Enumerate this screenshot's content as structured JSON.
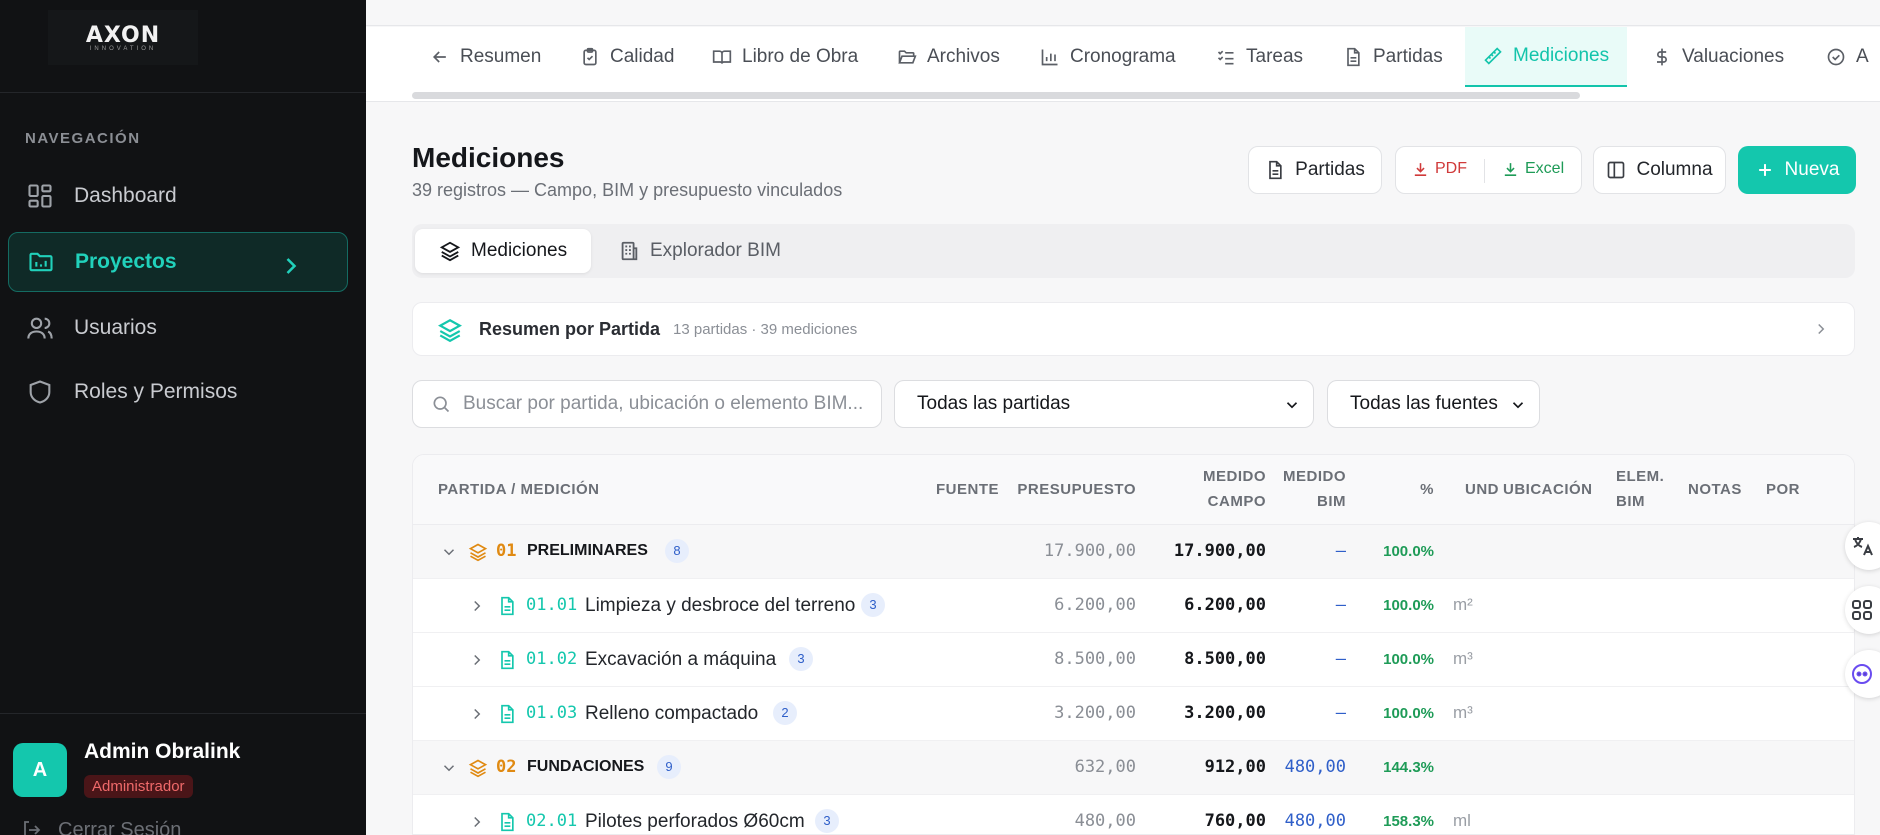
{
  "app": {
    "logo": "AXON",
    "logo_sub": "INNOVATION"
  },
  "sidebar": {
    "section_title": "NAVEGACIÓN",
    "items": [
      {
        "label": "Dashboard",
        "icon": "dashboard-icon"
      },
      {
        "label": "Proyectos",
        "icon": "folder-icon",
        "active": true
      },
      {
        "label": "Usuarios",
        "icon": "users-icon"
      },
      {
        "label": "Roles y Permisos",
        "icon": "shield-icon"
      }
    ],
    "user": {
      "initial": "A",
      "name": "Admin Obralink",
      "role": "Administrador"
    },
    "logout": "Cerrar Sesión"
  },
  "tabs": [
    {
      "label": "Resumen",
      "icon": "arrow-left-icon"
    },
    {
      "label": "Calidad",
      "icon": "clipboard-icon"
    },
    {
      "label": "Libro de Obra",
      "icon": "book-icon"
    },
    {
      "label": "Archivos",
      "icon": "folder-open-icon"
    },
    {
      "label": "Cronograma",
      "icon": "bar-chart-icon"
    },
    {
      "label": "Tareas",
      "icon": "checklist-icon"
    },
    {
      "label": "Partidas",
      "icon": "file-icon"
    },
    {
      "label": "Mediciones",
      "icon": "ruler-icon",
      "active": true
    },
    {
      "label": "Valuaciones",
      "icon": "dollar-icon"
    },
    {
      "label": "A",
      "icon": "check-circle-icon"
    }
  ],
  "header": {
    "title": "Mediciones",
    "subtitle": "39 registros — Campo, BIM y presupuesto vinculados",
    "buttons": {
      "partidas": "Partidas",
      "pdf": "PDF",
      "excel": "Excel",
      "columna": "Columna",
      "nueva": "Nueva"
    }
  },
  "view_tabs": [
    {
      "label": "Mediciones",
      "active": true
    },
    {
      "label": "Explorador BIM"
    }
  ],
  "resumen": {
    "title": "Resumen por Partida",
    "meta": "13 partidas · 39 mediciones"
  },
  "filters": {
    "search_placeholder": "Buscar por partida, ubicación o elemento BIM...",
    "partidas_select": "Todas las partidas",
    "fuentes_select": "Todas las fuentes"
  },
  "table": {
    "headers": {
      "partida": "PARTIDA / MEDICIÓN",
      "fuente": "FUENTE",
      "presupuesto": "PRESUPUESTO",
      "medido_campo": "MEDIDO\nCAMPO",
      "medido_bim": "MEDIDO\nBIM",
      "pct": "%",
      "und": "UND",
      "ubicacion": "UBICACIÓN",
      "elem_bim": "ELEM.\nBIM",
      "notas": "NOTAS",
      "por": "POR"
    },
    "rows": [
      {
        "type": "group",
        "code": "01",
        "name": "PRELIMINARES",
        "count": "8",
        "presupuesto": "17.900,00",
        "campo": "17.900,00",
        "bim": "—",
        "pct": "100.0%",
        "und": ""
      },
      {
        "type": "item",
        "code": "01.01",
        "name": "Limpieza y desbroce del terreno",
        "count": "3",
        "presupuesto": "6.200,00",
        "campo": "6.200,00",
        "bim": "—",
        "pct": "100.0%",
        "und": "m²"
      },
      {
        "type": "item",
        "code": "01.02",
        "name": "Excavación a máquina",
        "count": "3",
        "presupuesto": "8.500,00",
        "campo": "8.500,00",
        "bim": "—",
        "pct": "100.0%",
        "und": "m³"
      },
      {
        "type": "item",
        "code": "01.03",
        "name": "Relleno compactado",
        "count": "2",
        "presupuesto": "3.200,00",
        "campo": "3.200,00",
        "bim": "—",
        "pct": "100.0%",
        "und": "m³"
      },
      {
        "type": "group",
        "code": "02",
        "name": "FUNDACIONES",
        "count": "9",
        "presupuesto": "632,00",
        "campo": "912,00",
        "bim": "480,00",
        "pct": "144.3%",
        "und": ""
      },
      {
        "type": "item",
        "code": "02.01",
        "name": "Pilotes perforados Ø60cm",
        "count": "3",
        "presupuesto": "480,00",
        "campo": "760,00",
        "bim": "480,00",
        "pct": "158.3%",
        "und": "ml"
      }
    ]
  },
  "floating": [
    "translate-icon",
    "apps-icon",
    "assistant-icon"
  ],
  "colors": {
    "accent": "#14c7ad",
    "sidebar_bg": "#111214",
    "group_code": "#e08a12",
    "bim_value": "#2f5fc9",
    "pct": "#1e9b57",
    "pdf": "#d03a3a"
  }
}
